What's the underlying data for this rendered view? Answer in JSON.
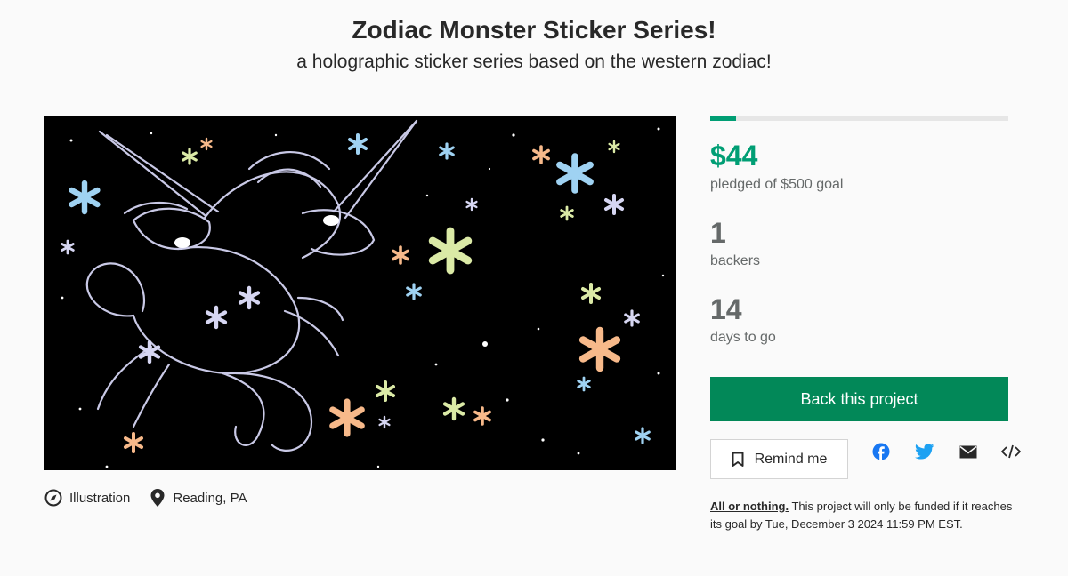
{
  "project": {
    "title": "Zodiac Monster Sticker Series!",
    "subtitle": "a holographic sticker series based on the western zodiac!"
  },
  "meta": {
    "category": "Illustration",
    "category_icon": "compass-icon",
    "location": "Reading, PA",
    "location_icon": "map-pin-icon"
  },
  "stats": {
    "progress_fraction": 0.088,
    "pledged": "$44",
    "pledged_label": "pledged of $500 goal",
    "backers": "1",
    "backers_label": "backers",
    "days": "14",
    "days_label": "days to go"
  },
  "actions": {
    "back_label": "Back this project",
    "remind_label": "Remind me",
    "share_icons": [
      "facebook-icon",
      "twitter-icon",
      "email-icon",
      "embed-icon"
    ]
  },
  "funding_note": {
    "link": "All or nothing.",
    "text": " This project will only be funded if it reaches its goal by Tue, December 3 2024 11:59 PM EST."
  },
  "colors": {
    "accent": "#009e74",
    "button": "#028858",
    "twitter": "#1da1f2",
    "facebook": "#1877f2"
  }
}
